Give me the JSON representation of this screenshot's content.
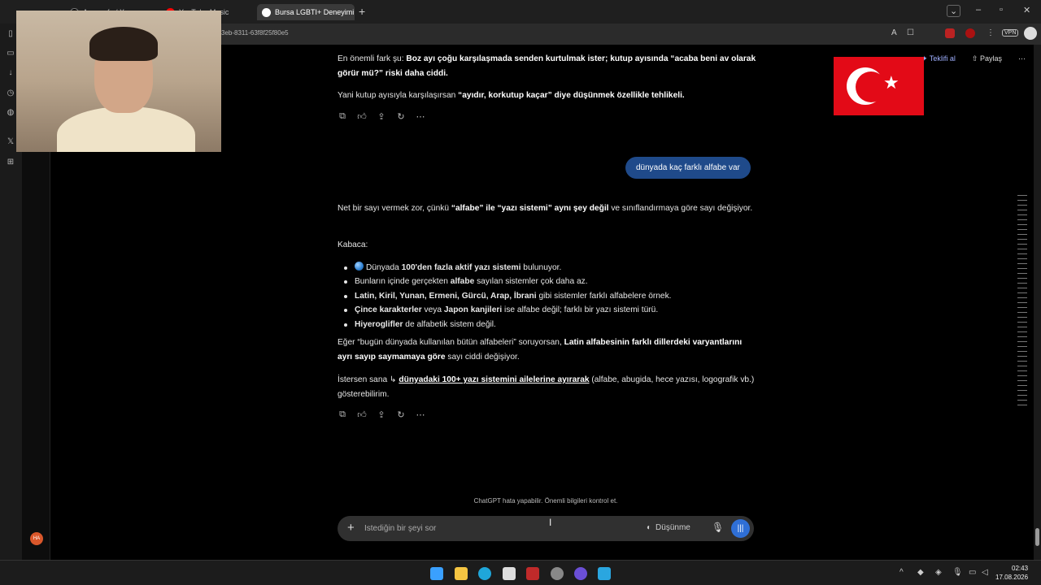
{
  "browser": {
    "tabs": [
      {
        "label": "Apacayfa / X"
      },
      {
        "label": "YouTube Music"
      },
      {
        "label": "Bursa LGBTI+ Deneyimi Öz"
      }
    ],
    "url": "3eb-8311-63f8f25f80e5",
    "vpn_label": "VPN"
  },
  "chat": {
    "topright": {
      "get_plus": "Teklifi al",
      "share": "Paylaş"
    },
    "prev_answer": {
      "p1_prefix": "En önemli fark şu: ",
      "p1_bold": "Boz ayı çoğu karşılaşmada senden kurtulmak ister; kutup ayısında “acaba beni av olarak görür mü?” riski daha ciddi.",
      "p2_prefix": "Yani kutup ayısıyla karşılaşırsan ",
      "p2_bold": "“ayıdır, korkutup kaçar” diye düşünmek özellikle tehlikeli."
    },
    "user_message": "dünyada kaç farklı alfabe var",
    "answer": {
      "intro_a": "Net bir sayı vermek zor, çünkü ",
      "intro_b": "“alfabe” ile “yazı sistemi” aynı şey değil",
      "intro_c": " ve sınıflandırmaya göre sayı değişiyor.",
      "kabaca": "Kabaca:",
      "b1_a": "Dünyada ",
      "b1_b": "100'den fazla aktif yazı sistemi",
      "b1_c": " bulunuyor.",
      "b2_a": "Bunların içinde gerçekten ",
      "b2_b": "alfabe",
      "b2_c": " sayılan sistemler çok daha az.",
      "b3_a": "Latin, Kiril, Yunan, Ermeni, Gürcü, Arap, İbrani",
      "b3_b": " gibi sistemler farklı alfabelere örnek.",
      "b4_a": "Çince karakterler",
      "b4_b": " veya ",
      "b4_c": "Japon kanjileri",
      "b4_d": " ise alfabe değil; farklı bir yazı sistemi türü.",
      "b5_a": "Hiyeroglifler",
      "b5_b": " de alfabetik sistem değil.",
      "p3_a": "Eğer “bugün dünyada kullanılan bütün alfabeleri” soruyorsan, ",
      "p3_b": "Latin alfabesinin farklı dillerdeki varyantlarını ayrı sayıp saymamaya göre",
      "p3_c": " sayı ciddi değişiyor.",
      "p4_a": "İstersen sana ",
      "p4_arrow": "↳",
      "p4_link": "dünyadaki 100+ yazı sistemini ailelerine ayırarak",
      "p4_c": " (alfabe, abugida, hece yazısı, logografik vb.) gösterebilirim."
    },
    "disclaimer": "ChatGPT hata yapabilir. Önemli bilgileri kontrol et.",
    "composer": {
      "placeholder": "İstediğin bir şeyi sor",
      "think_label": "Düşünme"
    },
    "avatar_initials": "HA"
  },
  "taskbar": {
    "time": "02:43",
    "date": "17.08.2026"
  }
}
